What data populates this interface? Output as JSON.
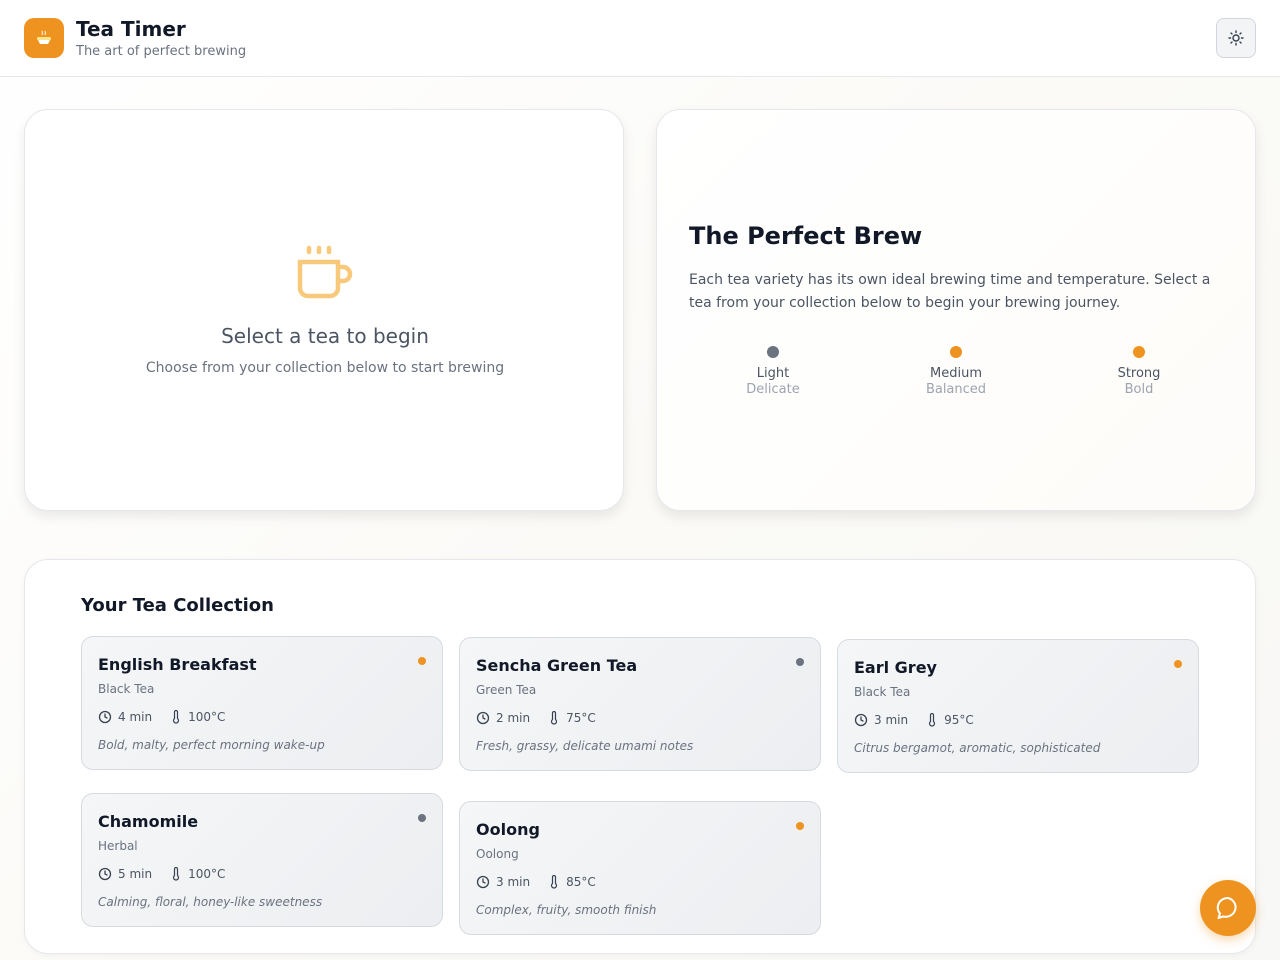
{
  "header": {
    "title": "Tea Timer",
    "subtitle": "The art of perfect brewing",
    "logo_icon": "teacup-icon",
    "theme_icon": "sun-icon"
  },
  "select_card": {
    "icon": "coffee-cup-icon",
    "title": "Select a tea to begin",
    "subtitle": "Choose from your collection below to start brewing"
  },
  "brew_card": {
    "title": "The Perfect Brew",
    "text": "Each tea variety has its own ideal brewing time and temperature. Select a tea from your collection below to begin your brewing journey.",
    "strengths": [
      {
        "label": "Light",
        "desc": "Delicate",
        "color": "#6b7280"
      },
      {
        "label": "Medium",
        "desc": "Balanced",
        "color": "#ef9320"
      },
      {
        "label": "Strong",
        "desc": "Bold",
        "color": "#ef9320"
      }
    ]
  },
  "collection": {
    "title": "Your Tea Collection",
    "teas": [
      {
        "name": "English Breakfast",
        "type": "Black Tea",
        "time": "4 min",
        "temp": "100°C",
        "desc": "Bold, malty, perfect morning wake-up",
        "dot_color": "#ef9320"
      },
      {
        "name": "Sencha Green Tea",
        "type": "Green Tea",
        "time": "2 min",
        "temp": "75°C",
        "desc": "Fresh, grassy, delicate umami notes",
        "dot_color": "#6b7280"
      },
      {
        "name": "Earl Grey",
        "type": "Black Tea",
        "time": "3 min",
        "temp": "95°C",
        "desc": "Citrus bergamot, aromatic, sophisticated",
        "dot_color": "#ef9320"
      },
      {
        "name": "Chamomile",
        "type": "Herbal",
        "time": "5 min",
        "temp": "100°C",
        "desc": "Calming, floral, honey-like sweetness",
        "dot_color": "#6b7280"
      },
      {
        "name": "Oolong",
        "type": "Oolong",
        "time": "3 min",
        "temp": "85°C",
        "desc": "Complex, fruity, smooth finish",
        "dot_color": "#ef9320"
      }
    ]
  },
  "chat": {
    "icon": "chat-bubble-icon"
  },
  "colors": {
    "accent": "#ef9320",
    "muted_dot": "#6b7280"
  }
}
